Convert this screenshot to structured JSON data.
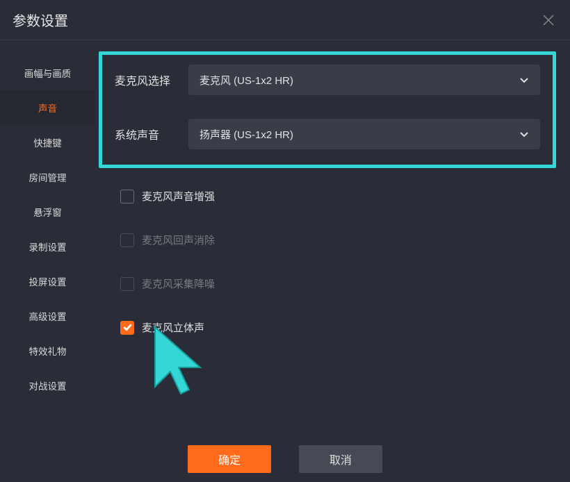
{
  "header": {
    "title": "参数设置"
  },
  "sidebar": {
    "items": [
      {
        "label": "画幅与画质"
      },
      {
        "label": "声音"
      },
      {
        "label": "快捷键"
      },
      {
        "label": "房间管理"
      },
      {
        "label": "悬浮窗"
      },
      {
        "label": "录制设置"
      },
      {
        "label": "投屏设置"
      },
      {
        "label": "高级设置"
      },
      {
        "label": "特效礼物"
      },
      {
        "label": "对战设置"
      }
    ],
    "activeIndex": 1
  },
  "audio": {
    "micLabel": "麦克风选择",
    "micValue": "麦克风 (US-1x2 HR)",
    "sysLabel": "系统声音",
    "sysValue": "扬声器 (US-1x2 HR)"
  },
  "checks": {
    "boost": {
      "label": "麦克风声音增强",
      "checked": false,
      "disabled": false
    },
    "echo": {
      "label": "麦克风回声消除",
      "checked": false,
      "disabled": true
    },
    "denoise": {
      "label": "麦克风采集降噪",
      "checked": false,
      "disabled": true
    },
    "stereo": {
      "label": "麦克风立体声",
      "checked": true,
      "disabled": false
    }
  },
  "footer": {
    "confirm": "确定",
    "cancel": "取消"
  }
}
